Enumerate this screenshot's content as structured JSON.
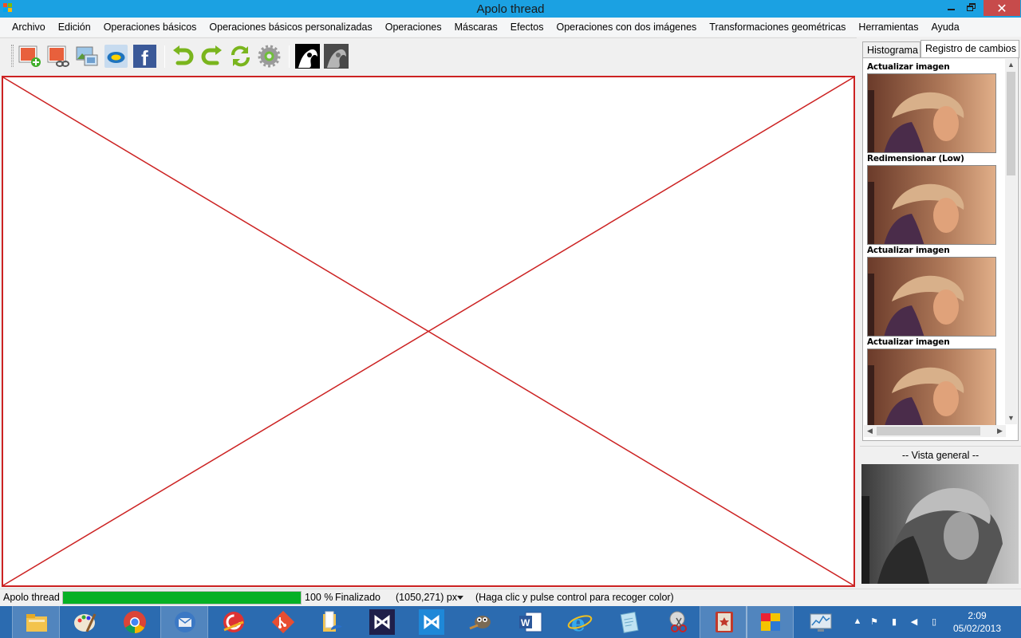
{
  "window": {
    "title": "Apolo thread"
  },
  "menu": [
    "Archivo",
    "Edición",
    "Operaciones básicos",
    "Operaciones básicos personalizadas",
    "Operaciones",
    "Máscaras",
    "Efectos",
    "Operaciones con dos imágenes",
    "Transformaciones geométricas",
    "Herramientas",
    "Ayuda"
  ],
  "toolbar": {
    "icons": [
      "new-image-icon",
      "link-image-icon",
      "picture-icon",
      "bing-icon",
      "facebook-icon",
      "undo-icon",
      "redo-icon",
      "refresh-icon",
      "settings-icon",
      "bw-image-icon",
      "grayscale-image-icon"
    ]
  },
  "tabs": {
    "histogram": "Histograma",
    "changelog": "Registro de cambios"
  },
  "history": [
    {
      "label": "Actualizar imagen"
    },
    {
      "label": "Redimensionar (Low)"
    },
    {
      "label": "Actualizar imagen"
    },
    {
      "label": "Actualizar imagen"
    }
  ],
  "overview": {
    "title": "-- Vista general --"
  },
  "status": {
    "app": "Apolo thread",
    "progress": 1.0,
    "percent": "100 %",
    "state": "Finalizado",
    "coords": "(1050,271) px",
    "hint": "(Haga clic y pulse control para recoger color)"
  },
  "taskbar": {
    "apps": [
      "file-explorer-icon",
      "paint-icon",
      "chrome-icon",
      "thunderbird-icon",
      "ccleaner-icon",
      "git-icon",
      "folder-icon",
      "visual-studio-icon",
      "vs-code-icon",
      "gimp-icon",
      "word-icon",
      "internet-explorer-icon",
      "notepad-icon",
      "snipping-tool-icon",
      "bookmark-app-icon",
      "apolo-app-icon",
      "performance-monitor-icon"
    ],
    "time": "2:09",
    "date": "05/02/2013"
  },
  "colors": {
    "titlebar": "#1ba1e2",
    "canvas_border": "#cc2222",
    "progress": "#06b025",
    "taskbar": "#2b6bb0"
  }
}
